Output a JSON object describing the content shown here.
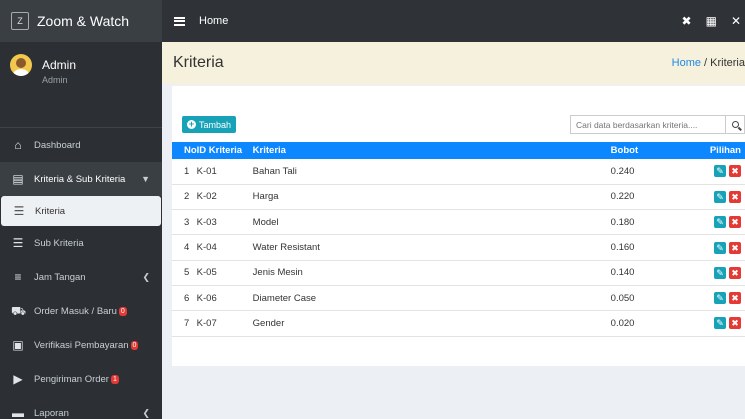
{
  "brand": {
    "logo": "Z",
    "name": "Zoom & Watch"
  },
  "user": {
    "name": "Admin",
    "role": "Admin"
  },
  "nav": [
    {
      "label": "Dashboard",
      "icon": "home-icon",
      "glyph": "⌂",
      "badge": ""
    },
    {
      "label": "Kriteria & Sub Kriteria",
      "icon": "list-box-icon",
      "glyph": "▤",
      "badge": ""
    },
    {
      "label": "Kriteria",
      "icon": "list-icon",
      "glyph": "☰",
      "badge": ""
    },
    {
      "label": "Sub Kriteria",
      "icon": "list-icon",
      "glyph": "☰",
      "badge": ""
    },
    {
      "label": "Jam Tangan",
      "icon": "database-icon",
      "glyph": "≡",
      "badge": ""
    },
    {
      "label": "Order Masuk / Baru",
      "icon": "cart-icon",
      "glyph": "⛟",
      "badge": "0"
    },
    {
      "label": "Verifikasi Pembayaran",
      "icon": "id-card-icon",
      "glyph": "▣",
      "badge": "0"
    },
    {
      "label": "Pengiriman Order",
      "icon": "truck-icon",
      "glyph": "▶",
      "badge": "1"
    },
    {
      "label": "Laporan",
      "icon": "printer-icon",
      "glyph": "▬",
      "badge": ""
    }
  ],
  "topbar": {
    "home": "Home"
  },
  "page": {
    "title": "Kriteria",
    "crumb_home": "Home",
    "crumb_sep": " / ",
    "crumb_current": "Kriteria"
  },
  "toolbar": {
    "add_label": "Tambah",
    "search_placeholder": "Cari data berdasarkan kriteria...."
  },
  "table": {
    "headers": {
      "no": "No",
      "id": "ID Kriteria",
      "name": "Kriteria",
      "bobot": "Bobot",
      "action": "Pilihan"
    },
    "rows": [
      {
        "no": "1",
        "id": "K-01",
        "name": "Bahan Tali",
        "bobot": "0.240"
      },
      {
        "no": "2",
        "id": "K-02",
        "name": "Harga",
        "bobot": "0.220"
      },
      {
        "no": "3",
        "id": "K-03",
        "name": "Model",
        "bobot": "0.180"
      },
      {
        "no": "4",
        "id": "K-04",
        "name": "Water Resistant",
        "bobot": "0.160"
      },
      {
        "no": "5",
        "id": "K-05",
        "name": "Jenis Mesin",
        "bobot": "0.140"
      },
      {
        "no": "6",
        "id": "K-06",
        "name": "Diameter Case",
        "bobot": "0.050"
      },
      {
        "no": "7",
        "id": "K-07",
        "name": "Gender",
        "bobot": "0.020"
      }
    ]
  },
  "colors": {
    "primary": "#0d87ff",
    "info": "#17a2b8",
    "danger": "#e53935",
    "sidebar": "#2c3034",
    "header_bg": "#f5f1dd"
  }
}
